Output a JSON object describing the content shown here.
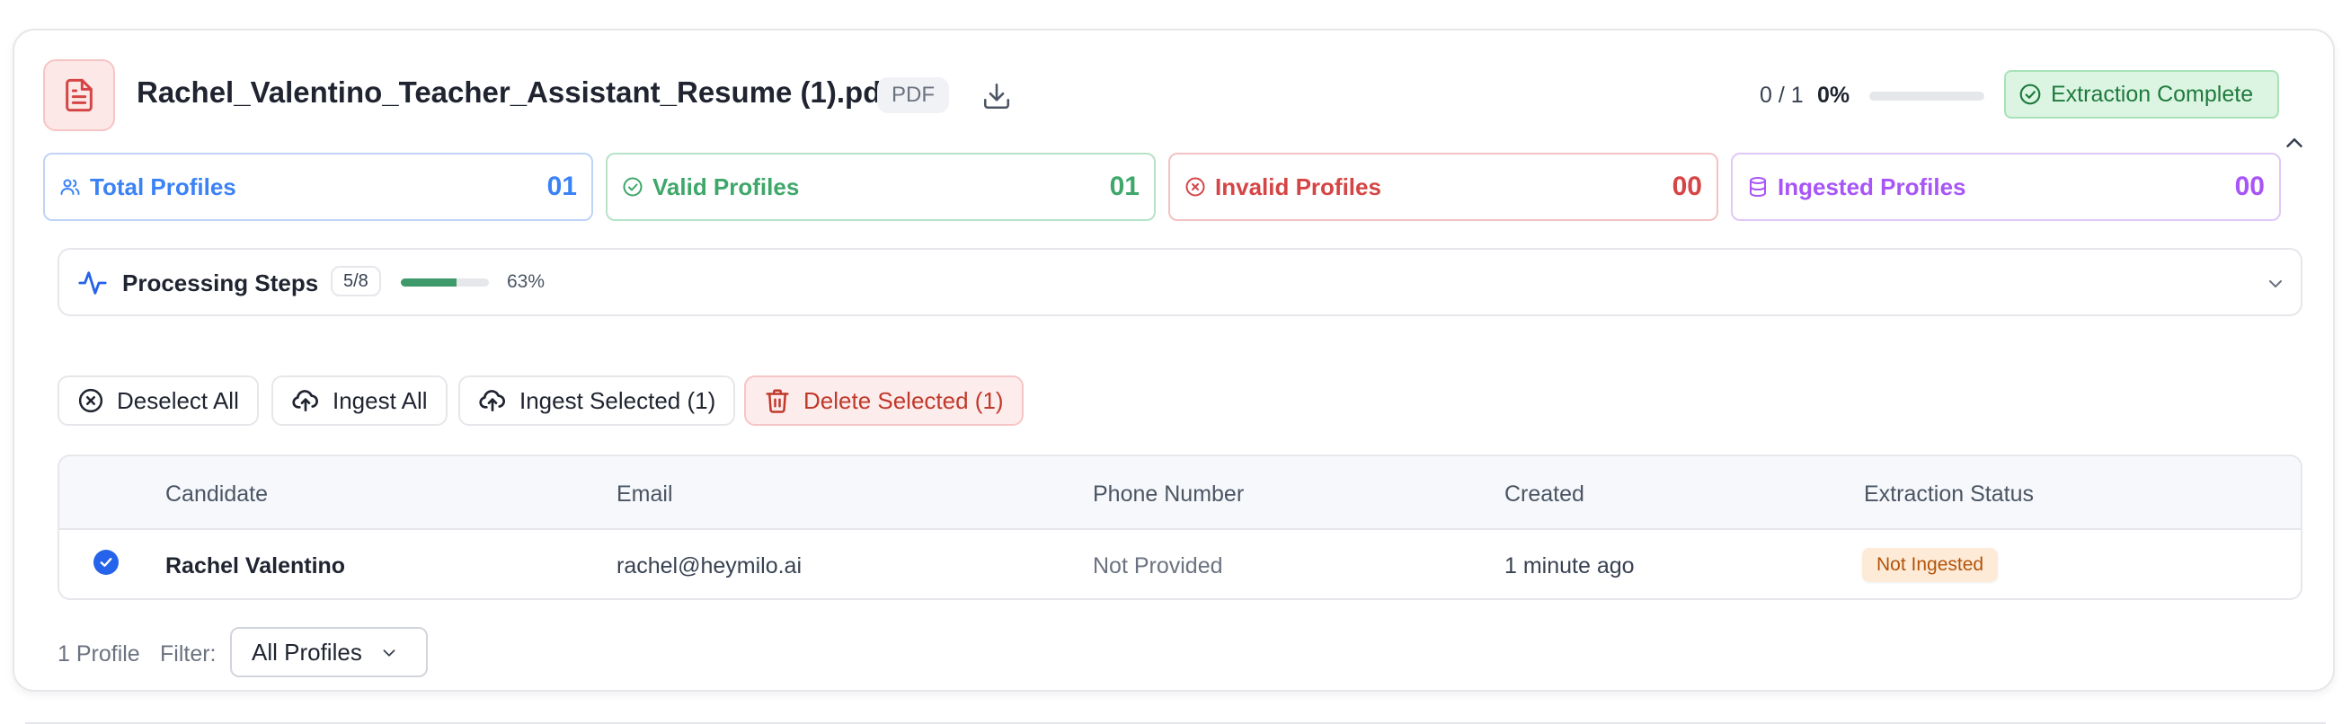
{
  "file": {
    "title": "Rachel_Valentino_Teacher_Assistant_Resume (1).pdf",
    "type_badge": "PDF",
    "icons": {
      "file": "file-text-icon",
      "download": "download-icon"
    }
  },
  "progress": {
    "count": "0 / 1",
    "percent_label": "0%",
    "fraction": 0
  },
  "status": {
    "label": "Extraction Complete",
    "icon": "check-circle-icon"
  },
  "stats": [
    {
      "label": "Total Profiles",
      "value": "01",
      "color": "#3b82f6",
      "border": "#bfd4f6",
      "icon": "users-icon"
    },
    {
      "label": "Valid Profiles",
      "value": "01",
      "color": "#3fa76a",
      "border": "#b6e3c7",
      "icon": "check-circle-icon"
    },
    {
      "label": "Invalid Profiles",
      "value": "00",
      "color": "#d64545",
      "border": "#f3c2c2",
      "icon": "x-circle-icon"
    },
    {
      "label": "Ingested Profiles",
      "value": "00",
      "color": "#a855f7",
      "border": "#dfc8f7",
      "icon": "database-icon"
    }
  ],
  "processing": {
    "title": "Processing Steps",
    "steps_badge": "5/8",
    "percent_label": "63%",
    "fraction": 0.63,
    "icon": "activity-icon"
  },
  "actions": {
    "deselect_all": "Deselect All",
    "ingest_all": "Ingest All",
    "ingest_selected": "Ingest Selected (1)",
    "delete_selected": "Delete Selected (1)"
  },
  "table": {
    "headers": {
      "candidate": "Candidate",
      "email": "Email",
      "phone": "Phone Number",
      "created": "Created",
      "status": "Extraction Status"
    },
    "rows": [
      {
        "selected": true,
        "candidate": "Rachel Valentino",
        "email": "rachel@heymilo.ai",
        "phone": "Not Provided",
        "created": "1 minute ago",
        "status": "Not Ingested"
      }
    ]
  },
  "footer": {
    "profile_count": "1 Profile",
    "filter_label": "Filter:",
    "filter_value": "All Profiles"
  },
  "colors": {
    "accent_blue": "#2563eb",
    "success_green": "#1f7a3d",
    "danger_red": "#c0392b",
    "warning_orange": "#b45309"
  }
}
